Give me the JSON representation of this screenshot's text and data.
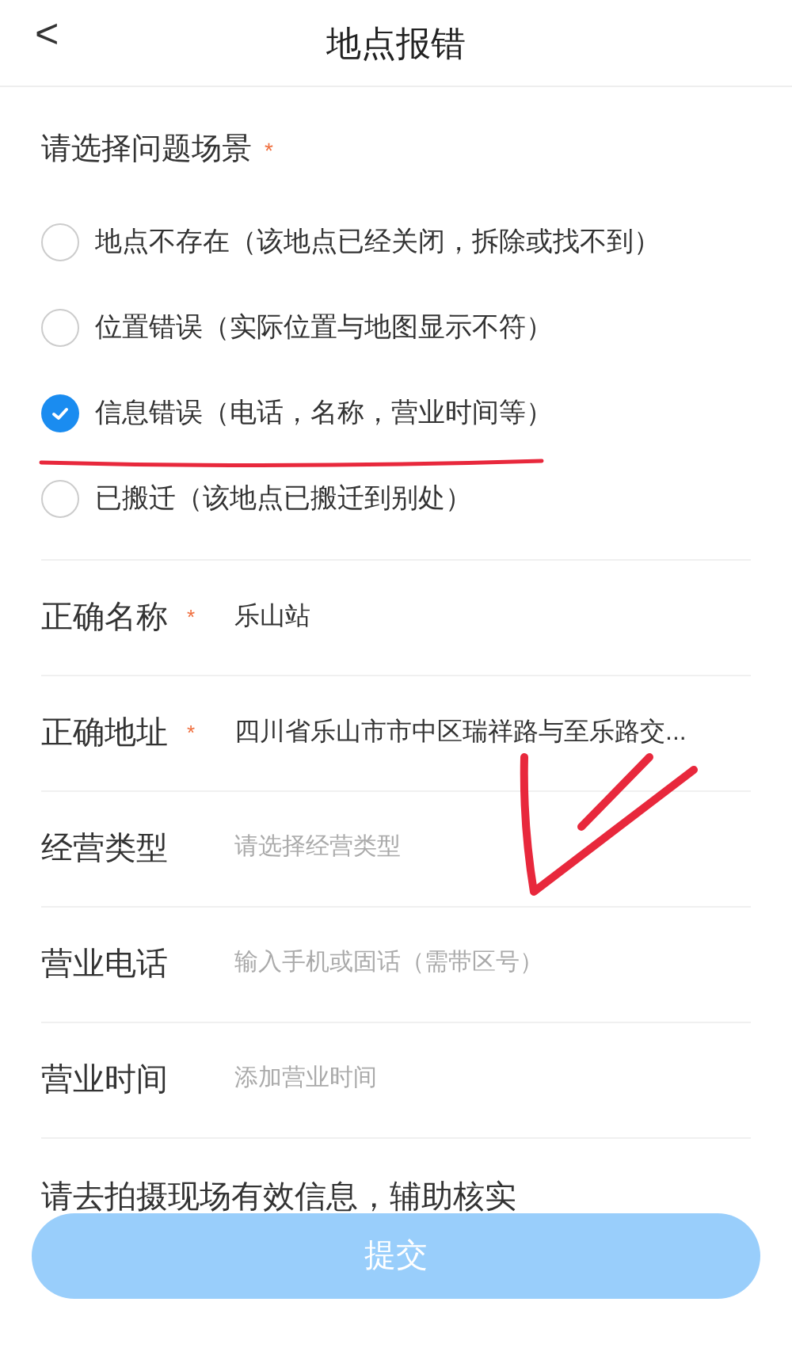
{
  "header": {
    "back": "<",
    "title": "地点报错"
  },
  "scene": {
    "label": "请选择问题场景",
    "required": "*",
    "options": [
      {
        "label": "地点不存在（该地点已经关闭，拆除或找不到）",
        "selected": false
      },
      {
        "label": "位置错误（实际位置与地图显示不符）",
        "selected": false
      },
      {
        "label": "信息错误（电话，名称，营业时间等）",
        "selected": true
      },
      {
        "label": "已搬迁（该地点已搬迁到别处）",
        "selected": false
      }
    ]
  },
  "fields": [
    {
      "label": "正确名称",
      "required": "*",
      "value": "乐山站"
    },
    {
      "label": "正确地址",
      "required": "*",
      "value": "四川省乐山市市中区瑞祥路与至乐路交..."
    },
    {
      "label": "经营类型",
      "placeholder": "请选择经营类型"
    },
    {
      "label": "营业电话",
      "placeholder": "输入手机或固话（需带区号）"
    },
    {
      "label": "营业时间",
      "placeholder": "添加营业时间"
    }
  ],
  "photo_hint": "请去拍摄现场有效信息，辅助核实",
  "submit": "提交"
}
